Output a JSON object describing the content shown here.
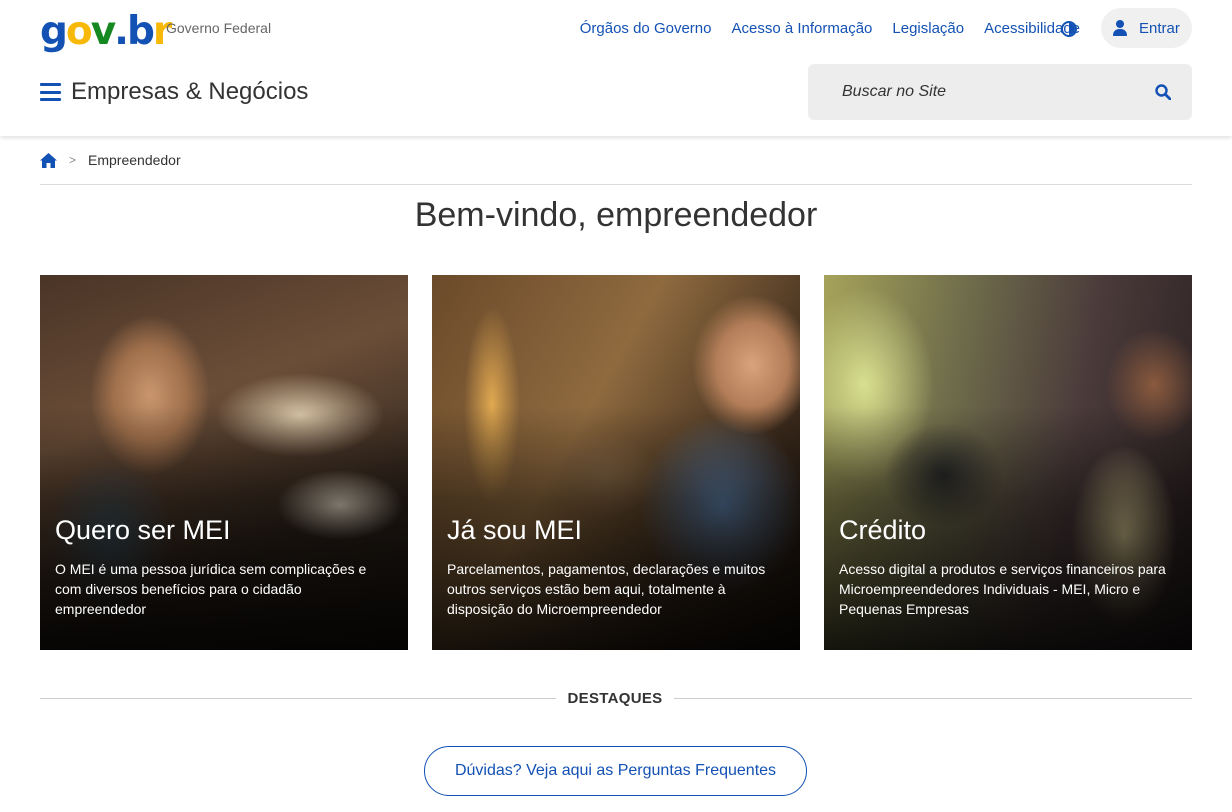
{
  "header": {
    "logo": {
      "g": "g",
      "o": "o",
      "v": "v",
      "dot": ".",
      "b": "b",
      "r": "r"
    },
    "logo_subtitle": "Governo Federal",
    "links": [
      "Órgãos do Governo",
      "Acesso à Informação",
      "Legislação",
      "Acessibilidade"
    ],
    "login_label": "Entrar",
    "site_title": "Empresas & Negócios",
    "search_placeholder": "Buscar no Site"
  },
  "breadcrumb": {
    "separator": ">",
    "current": "Empreendedor"
  },
  "page_title": "Bem-vindo, empreendedor",
  "cards": [
    {
      "title": "Quero ser MEI",
      "description": "O MEI é uma pessoa jurídica sem complicações e com diversos benefícios para o cidadão empreendedor"
    },
    {
      "title": "Já sou MEI",
      "description": "Parcelamentos, pagamentos, declarações e muitos outros serviços estão bem aqui, totalmente à disposição do Microempreendedor"
    },
    {
      "title": "Crédito",
      "description": "Acesso digital a produtos e serviços financeiros para Microempreendedores Individuais - MEI, Micro e Pequenas Empresas"
    }
  ],
  "highlights": {
    "title": "DESTAQUES",
    "faq_button": "Dúvidas? Veja aqui as Perguntas Frequentes"
  },
  "colors": {
    "primary_blue": "#1351b4",
    "logo_yellow": "#f8b808",
    "logo_green": "#168821"
  },
  "icons": [
    "contrast-icon",
    "user-icon",
    "hamburger-menu-icon",
    "search-icon",
    "home-icon"
  ]
}
